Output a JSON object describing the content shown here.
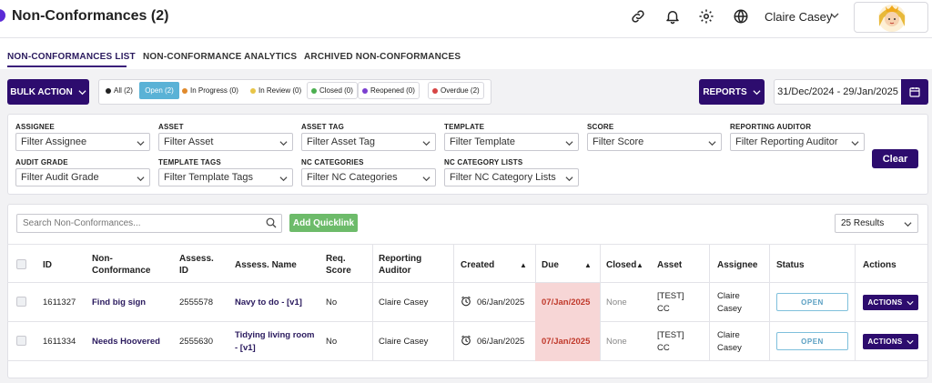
{
  "header": {
    "title": "Non-Conformances (2)",
    "user_name": "Claire Casey",
    "icons": [
      "link-icon",
      "bell-icon",
      "gear-icon",
      "globe-icon"
    ]
  },
  "tabs": [
    {
      "label": "NON-CONFORMANCES LIST",
      "active": true
    },
    {
      "label": "NON-CONFORMANCE ANALYTICS",
      "active": false
    },
    {
      "label": "ARCHIVED NON-CONFORMANCES",
      "active": false
    }
  ],
  "toolbar": {
    "bulk_action": "BULK ACTION",
    "reports": "REPORTS",
    "date_range": "31/Dec/2024 - 29/Jan/2025"
  },
  "status_filters": {
    "all": "All (2)",
    "open": "Open (2)",
    "in_progress": "In Progress (0)",
    "in_review": "In Review (0)",
    "closed": "Closed (0)",
    "reopened": "Reopened (0)",
    "overdue": "Overdue (2)"
  },
  "colors": {
    "primary": "#2d0c6e",
    "open_badge": "#5ab2d6",
    "in_progress": "#e08a2c",
    "in_review": "#e8c547",
    "closed": "#4caf50",
    "reopened": "#7b3fd0",
    "overdue": "#d64545",
    "quicklink": "#6dbb6a",
    "due_bg": "#f7d6d6"
  },
  "filters": {
    "assignee": {
      "label": "ASSIGNEE",
      "value": "Filter Assignee"
    },
    "asset": {
      "label": "ASSET",
      "value": "Filter Asset"
    },
    "asset_tag": {
      "label": "ASSET TAG",
      "value": "Filter Asset Tag"
    },
    "template": {
      "label": "TEMPLATE",
      "value": "Filter Template"
    },
    "score": {
      "label": "SCORE",
      "value": "Filter Score"
    },
    "reporting_auditor": {
      "label": "REPORTING AUDITOR",
      "value": "Filter Reporting Auditor"
    },
    "audit_grade": {
      "label": "AUDIT GRADE",
      "value": "Filter Audit Grade"
    },
    "template_tags": {
      "label": "TEMPLATE TAGS",
      "value": "Filter Template Tags"
    },
    "nc_categories": {
      "label": "NC CATEGORIES",
      "value": "Filter NC Categories"
    },
    "nc_category_lists": {
      "label": "NC CATEGORY LISTS",
      "value": "Filter NC Category Lists"
    },
    "clear": "Clear"
  },
  "table": {
    "search_placeholder": "Search Non-Conformances...",
    "add_quicklink": "Add Quicklink",
    "results": "25 Results",
    "headers": {
      "id": "ID",
      "nc_line1": "Non-",
      "nc_line2": "Conformance",
      "assess_id_line1": "Assess.",
      "assess_id_line2": "ID",
      "assess_name": "Assess. Name",
      "req_line1": "Req.",
      "req_line2": "Score",
      "auditor_line1": "Reporting",
      "auditor_line2": "Auditor",
      "created": "Created",
      "due": "Due",
      "closed": "Closed",
      "asset": "Asset",
      "assignee": "Assignee",
      "status": "Status",
      "actions": "Actions"
    },
    "rows": [
      {
        "id": "1611327",
        "nc": "Find big sign",
        "assess_id": "2555578",
        "assess_name_l1": "Navy to do - [v1]",
        "assess_name_l2": "",
        "req_score": "No",
        "auditor": "Claire Casey",
        "created": "06/Jan/2025",
        "due": "07/Jan/2025",
        "closed": "None",
        "asset_l1": "[TEST]",
        "asset_l2": "CC",
        "assignee_l1": "Claire",
        "assignee_l2": "Casey",
        "status": "OPEN",
        "actions": "ACTIONS"
      },
      {
        "id": "1611334",
        "nc": "Needs Hoovered",
        "assess_id": "2555630",
        "assess_name_l1": "Tidying living room",
        "assess_name_l2": "- [v1]",
        "req_score": "No",
        "auditor": "Claire Casey",
        "created": "06/Jan/2025",
        "due": "07/Jan/2025",
        "closed": "None",
        "asset_l1": "[TEST]",
        "asset_l2": "CC",
        "assignee_l1": "Claire",
        "assignee_l2": "Casey",
        "status": "OPEN",
        "actions": "ACTIONS"
      }
    ]
  }
}
